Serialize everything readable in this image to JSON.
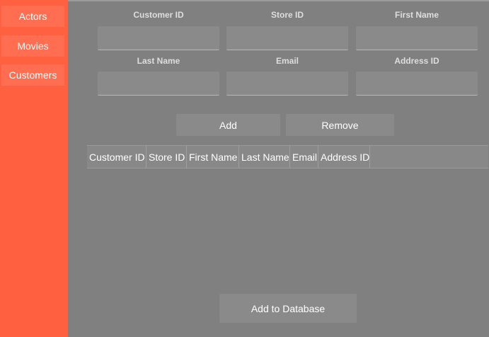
{
  "sidebar": {
    "items": [
      {
        "label": "Actors"
      },
      {
        "label": "Movies"
      },
      {
        "label": "Customers"
      }
    ]
  },
  "form": {
    "fields": [
      {
        "label": "Customer ID",
        "value": "",
        "placeholder": ""
      },
      {
        "label": "Store ID",
        "value": "",
        "placeholder": ""
      },
      {
        "label": "First Name",
        "value": "",
        "placeholder": ""
      },
      {
        "label": "Last Name",
        "value": "",
        "placeholder": ""
      },
      {
        "label": "Email",
        "value": "",
        "placeholder": ""
      },
      {
        "label": "Address ID",
        "value": "",
        "placeholder": ""
      }
    ]
  },
  "actions": {
    "add_label": "Add",
    "remove_label": "Remove",
    "add_to_db_label": "Add to Database"
  },
  "table": {
    "columns": [
      "Customer ID",
      "Store ID",
      "First Name",
      "Last Name",
      "Email",
      "Address ID"
    ],
    "rows": []
  },
  "colors": {
    "sidebar": "#ff6040",
    "sidebar_button": "#ff6e50",
    "background": "#808080",
    "control": "#8a8a8a"
  }
}
